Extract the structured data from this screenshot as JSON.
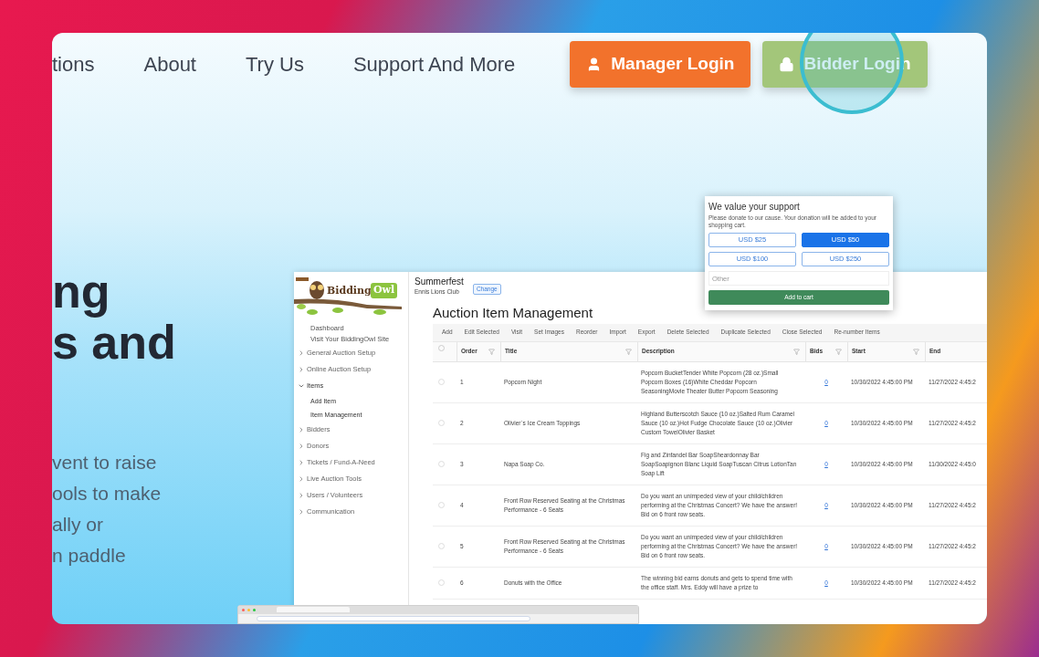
{
  "nav": {
    "links": [
      {
        "label": "tions"
      },
      {
        "label": "About"
      },
      {
        "label": "Try Us"
      },
      {
        "label": "Support And More"
      }
    ],
    "buttons": [
      {
        "label": "Manager Login",
        "kind": "manager"
      },
      {
        "label": "Bidder Login",
        "kind": "bidder"
      }
    ]
  },
  "hero": {
    "heading_lines": [
      "ng",
      "s and"
    ],
    "paragraph_lines": [
      "vent to raise",
      "ools to make",
      "ally or",
      "n paddle"
    ]
  },
  "app": {
    "logo": {
      "word_1": "Bidding",
      "word_2": "Owl"
    },
    "sidebar": [
      {
        "label": "Dashboard",
        "kind": "link"
      },
      {
        "label": "Visit Your BiddingOwl Site",
        "kind": "link"
      },
      {
        "label": "General Auction Setup",
        "kind": "group",
        "expanded": false
      },
      {
        "label": "Online Auction Setup",
        "kind": "group",
        "expanded": false
      },
      {
        "label": "Items",
        "kind": "group",
        "expanded": true,
        "children": [
          {
            "label": "Add Item"
          },
          {
            "label": "Item Management"
          }
        ]
      },
      {
        "label": "Bidders",
        "kind": "group",
        "expanded": false
      },
      {
        "label": "Donors",
        "kind": "group",
        "expanded": false
      },
      {
        "label": "Tickets / Fund-A-Need",
        "kind": "group",
        "expanded": false
      },
      {
        "label": "Live Auction Tools",
        "kind": "group",
        "expanded": false
      },
      {
        "label": "Users / Volunteers",
        "kind": "group",
        "expanded": false
      },
      {
        "label": "Communication",
        "kind": "group",
        "expanded": false
      }
    ],
    "event": {
      "name": "Summerfest",
      "org": "Ennis Lions Club",
      "change": "Change"
    },
    "title": "Auction Item Management",
    "toolbar": [
      "Add",
      "Edit Selected",
      "Visit",
      "Set Images",
      "Reorder",
      "Import",
      "Export",
      "Delete Selected",
      "Duplicate Selected",
      "Close Selected",
      "Re-number Items"
    ],
    "table": {
      "select_all": {
        "checked": false
      },
      "columns": [
        {
          "label": "Order",
          "filter": true
        },
        {
          "label": "Title",
          "filter": true
        },
        {
          "label": "Description",
          "filter": true
        },
        {
          "label": "Bids",
          "filter": true
        },
        {
          "label": "Start",
          "filter": true
        },
        {
          "label": "End",
          "filter": false
        }
      ],
      "rows": [
        {
          "checked": false,
          "order": "1",
          "title": "Popcorn Night",
          "description": "Popcorn BucketTender White Popcorn (28 oz.)Small Popcorn Boxes (16)White Cheddar Popcorn SeasoningMovie Theater Butter Popcorn Seasoning",
          "bids": "0",
          "start": "10/30/2022 4:45:00 PM",
          "end": "11/27/2022 4:45:2"
        },
        {
          "checked": false,
          "order": "2",
          "title": "Olivier`s Ice Cream Toppings",
          "description": "Highland Butterscotch Sauce (10 oz.)Salted Rum Caramel Sauce (10 oz.)Hot Fudge Chocolate Sauce (10 oz.)Olivier Custom TowelOlivier Basket",
          "bids": "0",
          "start": "10/30/2022 4:45:00 PM",
          "end": "11/27/2022 4:45:2"
        },
        {
          "checked": false,
          "order": "3",
          "title": "Napa Soap Co.",
          "description": "Fig and Zinfandel Bar SoapSheardonnay Bar SoapSoapignon Blanc Liquid SoapTuscan Citrus LotionTan Soap Lift",
          "bids": "0",
          "start": "10/30/2022 4:45:00 PM",
          "end": "11/30/2022 4:45:0"
        },
        {
          "checked": false,
          "order": "4",
          "title": "Front Row Reserved Seating at the Christmas Performance - 6 Seats",
          "description": "Do you want an unimpeded view of your child/children performing at the Christmas Concert? We have the answer! Bid on 6 front row seats.",
          "bids": "0",
          "start": "10/30/2022 4:45:00 PM",
          "end": "11/27/2022 4:45:2"
        },
        {
          "checked": false,
          "order": "5",
          "title": "Front Row Reserved Seating at the Christmas Performance - 6 Seats",
          "description": "Do you want an unimpeded view of your child/children performing at the Christmas Concert? We have the answer! Bid on 6 front row seats.",
          "bids": "0",
          "start": "10/30/2022 4:45:00 PM",
          "end": "11/27/2022 4:45:2"
        },
        {
          "checked": false,
          "order": "6",
          "title": "Donuts with the Office",
          "description": "The winning bid earns donuts and gets to spend time with the office staff. Mrs. Eddy will have a prize to",
          "bids": "0",
          "start": "10/30/2022 4:45:00 PM",
          "end": "11/27/2022 4:45:2"
        }
      ]
    }
  },
  "donation_popup": {
    "title": "We value your support",
    "text": "Please donate to our cause. Your donation will be added to your shopping cart.",
    "amounts": [
      {
        "label": "USD $25",
        "selected": false
      },
      {
        "label": "USD $50",
        "selected": true
      },
      {
        "label": "USD $100",
        "selected": false
      },
      {
        "label": "USD $250",
        "selected": false
      }
    ],
    "other_placeholder": "Other",
    "button": "Add to cart"
  }
}
